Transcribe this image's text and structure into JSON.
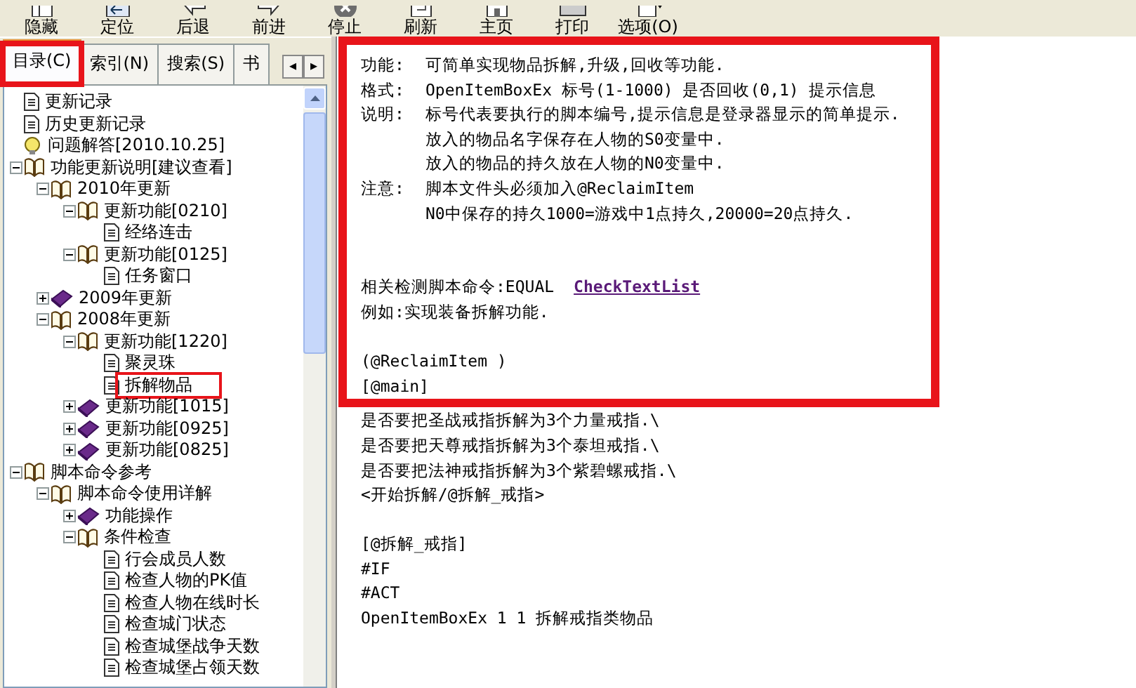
{
  "toolbar": {
    "buttons": [
      "隐藏",
      "定位",
      "后退",
      "前进",
      "停止",
      "刷新",
      "主页",
      "打印",
      "选项(O)"
    ]
  },
  "tabs": [
    {
      "label": "目录(C)",
      "selected": true
    },
    {
      "label": "索引(N)",
      "selected": false
    },
    {
      "label": "搜索(S)",
      "selected": false
    },
    {
      "label": "书",
      "selected": false
    }
  ],
  "tab_scroll": [
    "◂",
    "▸"
  ],
  "tree": [
    {
      "label": "更新记录",
      "kind": "page"
    },
    {
      "label": "历史更新记录",
      "kind": "page"
    },
    {
      "label": "问题解答[2010.10.25]",
      "kind": "help"
    },
    {
      "label": "功能更新说明[建议查看]",
      "kind": "book",
      "expanded": true,
      "children": [
        {
          "label": "2010年更新",
          "kind": "book",
          "expanded": true,
          "children": [
            {
              "label": "更新功能[0210]",
              "kind": "book",
              "expanded": true,
              "children": [
                {
                  "label": "经络连击",
                  "kind": "page"
                }
              ]
            },
            {
              "label": "更新功能[0125]",
              "kind": "book",
              "expanded": true,
              "children": [
                {
                  "label": "任务窗口",
                  "kind": "page"
                }
              ]
            }
          ]
        },
        {
          "label": "2009年更新",
          "kind": "book",
          "expanded": false
        },
        {
          "label": "2008年更新",
          "kind": "book",
          "expanded": true,
          "children": [
            {
              "label": "更新功能[1220]",
              "kind": "book",
              "expanded": true,
              "children": [
                {
                  "label": "聚灵珠",
                  "kind": "page"
                },
                {
                  "label": "拆解物品",
                  "kind": "page"
                }
              ]
            },
            {
              "label": "更新功能[1015]",
              "kind": "book",
              "expanded": false
            },
            {
              "label": "更新功能[0925]",
              "kind": "book",
              "expanded": false
            },
            {
              "label": "更新功能[0825]",
              "kind": "book",
              "expanded": false
            }
          ]
        }
      ]
    },
    {
      "label": "脚本命令参考",
      "kind": "book",
      "expanded": true,
      "children": [
        {
          "label": "脚本命令使用详解",
          "kind": "book",
          "expanded": true,
          "children": [
            {
              "label": "功能操作",
              "kind": "book",
              "expanded": false
            },
            {
              "label": "条件检查",
              "kind": "book",
              "expanded": true,
              "children": [
                {
                  "label": "行会成员人数",
                  "kind": "page"
                },
                {
                  "label": "检查人物的PK值",
                  "kind": "page"
                },
                {
                  "label": "检查人物在线时长",
                  "kind": "page"
                },
                {
                  "label": "检查城门状态",
                  "kind": "page"
                },
                {
                  "label": "检查城堡战争天数",
                  "kind": "page"
                },
                {
                  "label": "检查城堡占领天数",
                  "kind": "page"
                }
              ]
            }
          ]
        }
      ]
    }
  ],
  "content": [
    {
      "kind": "field",
      "label": "功能:",
      "text": "可简单实现物品拆解,升级,回收等功能."
    },
    {
      "kind": "field",
      "label": "格式:",
      "text": "OpenItemBoxEx 标号(1-1000) 是否回收(0,1) 提示信息"
    },
    {
      "kind": "field",
      "label": "说明:",
      "text": "标号代表要执行的脚本编号,提示信息是登录器显示的简单提示."
    },
    {
      "kind": "indent",
      "text": "放入的物品名字保存在人物的S0变量中."
    },
    {
      "kind": "indent",
      "text": "放入的物品的持久放在人物的N0变量中."
    },
    {
      "kind": "field",
      "label": "注意:",
      "text": "脚本文件头必须加入@ReclaimItem"
    },
    {
      "kind": "indent",
      "text": "N0中保存的持久1000=游戏中1点持久,20000=20点持久."
    },
    {
      "kind": "gap"
    },
    {
      "kind": "gap"
    },
    {
      "kind": "link",
      "text": "相关检测脚本命令:EQUAL",
      "link": "CheckTextList"
    },
    {
      "kind": "line",
      "text": "例如:实现装备拆解功能."
    },
    {
      "kind": "gap"
    },
    {
      "kind": "line",
      "text": "(@ReclaimItem )"
    },
    {
      "kind": "line",
      "text": "[@main]"
    },
    {
      "kind": "line",
      "text": "是否要把圣战戒指拆解为3个力量戒指.\\"
    },
    {
      "kind": "line",
      "text": "是否要把天尊戒指拆解为3个泰坦戒指.\\"
    },
    {
      "kind": "line",
      "text": "是否要把法神戒指拆解为3个紫碧螺戒指.\\"
    },
    {
      "kind": "line",
      "text": "<开始拆解/@拆解_戒指>"
    },
    {
      "kind": "gap"
    },
    {
      "kind": "line",
      "text": "[@拆解_戒指]"
    },
    {
      "kind": "line",
      "text": "#IF"
    },
    {
      "kind": "line",
      "text": "#ACT"
    },
    {
      "kind": "line",
      "text": "OpenItemBoxEx 1 1 拆解戒指类物品"
    }
  ]
}
